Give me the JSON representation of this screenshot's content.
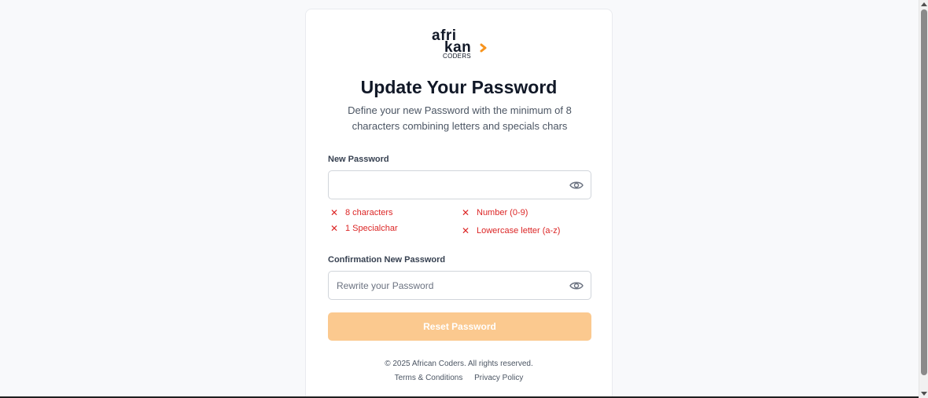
{
  "logo": {
    "line1": "afri",
    "line2": "kan",
    "line3": "CODERS",
    "accent": "#f7941d"
  },
  "page": {
    "title": "Update Your Password",
    "subtitle": "Define your new Password with the minimum of 8 characters combining letters and specials chars"
  },
  "new_password": {
    "label": "New Password",
    "value": "",
    "placeholder": "",
    "icon": "eye-icon"
  },
  "rules": [
    {
      "label": "8 characters",
      "met": false
    },
    {
      "label": "Number (0-9)",
      "met": false
    },
    {
      "label": "1 Specialchar",
      "met": false
    },
    {
      "label": "Lowercase letter (a-z)",
      "met": false
    }
  ],
  "confirm_password": {
    "label": "Confirmation New Password",
    "value": "",
    "placeholder": "Rewrite your Password",
    "icon": "eye-icon"
  },
  "button": {
    "label": "Reset Password",
    "color": "#fbc98f"
  },
  "footer": {
    "copyright": "© 2025 African Coders. All rights reserved.",
    "terms": "Terms & Conditions",
    "privacy": "Privacy Policy"
  },
  "colors": {
    "error": "#dc2626",
    "background": "#f8f9fb",
    "card": "#ffffff"
  }
}
